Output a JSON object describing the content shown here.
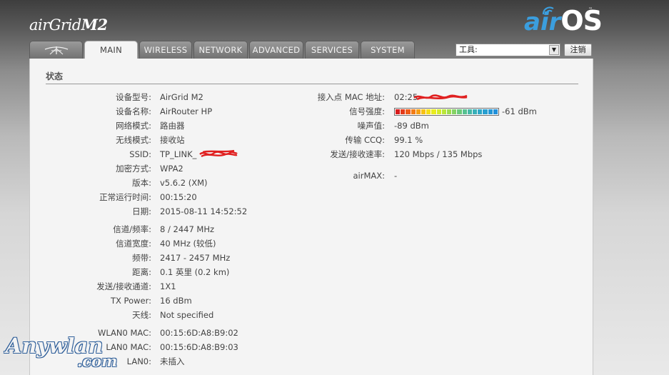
{
  "header": {
    "brand_left": {
      "prefix": "air",
      "name": "Grid",
      "model": "M2"
    },
    "brand_right": {
      "air": "air",
      "os": "OS",
      "tm": "™"
    },
    "tools": {
      "selected": "工具:"
    },
    "logout_label": "注销"
  },
  "tabs": [
    {
      "label": "",
      "icon": "ubiquiti-logo-icon",
      "active": false
    },
    {
      "label": "MAIN",
      "active": true
    },
    {
      "label": "WIRELESS",
      "active": false
    },
    {
      "label": "NETWORK",
      "active": false
    },
    {
      "label": "ADVANCED",
      "active": false
    },
    {
      "label": "SERVICES",
      "active": false
    },
    {
      "label": "SYSTEM",
      "active": false
    }
  ],
  "status": {
    "title": "状态",
    "left": [
      {
        "label": "设备型号:",
        "value": "AirGrid M2"
      },
      {
        "label": "设备名称:",
        "value": "AirRouter HP"
      },
      {
        "label": "网络模式:",
        "value": "路由器"
      },
      {
        "label": "无线模式:",
        "value": "接收站"
      },
      {
        "label": "SSID:",
        "value": "TP_LINK_"
      },
      {
        "label": "加密方式:",
        "value": "WPA2"
      },
      {
        "label": "版本:",
        "value": "v5.6.2 (XM)"
      },
      {
        "label": "正常运行时间:",
        "value": "00:15:20"
      },
      {
        "label": "日期:",
        "value": "2015-08-11 14:52:52"
      },
      {
        "label": "信道/频率:",
        "value": "8 / 2447 MHz"
      },
      {
        "label": "信道宽度:",
        "value": "40 MHz (较低)"
      },
      {
        "label": "频带:",
        "value": "2417 - 2457 MHz"
      },
      {
        "label": "距离:",
        "value": "0.1 英里 (0.2 km)"
      },
      {
        "label": "发送/接收通道:",
        "value": "1X1"
      },
      {
        "label": "TX Power:",
        "value": "16 dBm"
      },
      {
        "label": "天线:",
        "value": "Not specified"
      },
      {
        "label": "WLAN0 MAC:",
        "value": "00:15:6D:A8:B9:02"
      },
      {
        "label": "LAN0 MAC:",
        "value": "00:15:6D:A8:B9:03"
      },
      {
        "label": "LAN0:",
        "value": "未插入"
      }
    ],
    "right": {
      "ap_mac": {
        "label": "接入点 MAC 地址:",
        "value": "02:25"
      },
      "signal": {
        "label": "信号强度:",
        "value": "-61 dBm",
        "level": 1.0
      },
      "noise": {
        "label": "噪声值:",
        "value": "-89 dBm"
      },
      "ccq": {
        "label": "传输 CCQ:",
        "value": "99.1 %"
      },
      "rate": {
        "label": "发送/接收速率:",
        "value": "120 Mbps / 135 Mbps"
      },
      "airmax": {
        "label": "airMAX:",
        "value": "-"
      }
    }
  },
  "signal_colors": [
    "#d81c1c",
    "#e43a1a",
    "#ee5a18",
    "#f27c16",
    "#f59f14",
    "#f7c114",
    "#f5de16",
    "#e9ec1e",
    "#d3ec2a",
    "#b9e63a",
    "#9edc4e",
    "#84d264",
    "#6bc97b",
    "#56c191",
    "#45b8a6",
    "#38b0b8",
    "#2ea7c6",
    "#289fd0",
    "#2497d6",
    "#2290da"
  ],
  "accent": "#3b9ede",
  "watermark": {
    "line1": "Anywlan",
    "line2": ".com"
  }
}
